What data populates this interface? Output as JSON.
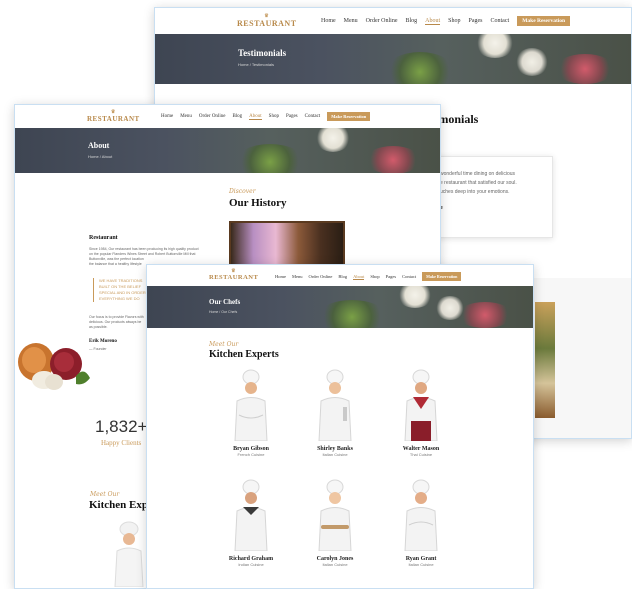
{
  "win_back": {
    "logo": "RESTAURANT",
    "menu": [
      "Home",
      "Menu",
      "Order Online",
      "Blog",
      "About",
      "Shop",
      "Pages",
      "Contact"
    ],
    "reservation": "Make Reservation",
    "hero_title": "Testimonials",
    "breadcrumb": "Home / Testimonials",
    "section_heading": "imonials",
    "quote_lines": [
      "wonderful time dining on delicious",
      "e restaurant that satisfied our soul.",
      "uches deep into your emotions."
    ],
    "quote_author": "e"
  },
  "win_mid": {
    "logo": "RESTAURANT",
    "menu": [
      "Home",
      "Menu",
      "Order Online",
      "Blog",
      "About",
      "Shop",
      "Pages",
      "Contact"
    ],
    "reservation": "Make Reservation",
    "hero_title": "About",
    "breadcrumb": "Home / About",
    "discover": "Discover",
    "history_heading": "Our History",
    "restaurant_label": "Restaurant",
    "body_lines": [
      "Since 1984, Our restaurant has been producing its high quality product",
      "on the popular Flanders Wines Street and Robert Buttonville Mill that",
      "Buttonville, was the perfect location",
      "the balance that a healthy lifestyle"
    ],
    "callout_lines": [
      "WE HAVE TRADITIONS",
      "BUILT ON THE BELIEF",
      "SPECIAL AND IN ORDER",
      "EVERYTHING WE DO"
    ],
    "body2_lines": [
      "Our focus is to provide Flavors with",
      "delicious. Our products always be",
      "as possible."
    ],
    "author_name": "Erik Moreno",
    "author_role": "— Founder",
    "stat_value": "1,832+",
    "stat_label": "Happy Clients",
    "meet_label": "Meet Our",
    "kitchen_partial": "Kitchen Exp"
  },
  "win_front": {
    "logo": "RESTAURANT",
    "menu": [
      "Home",
      "Menu",
      "Order Online",
      "Blog",
      "About",
      "Shop",
      "Pages",
      "Contact"
    ],
    "reservation": "Make Reservation",
    "hero_title": "Our Chefs",
    "breadcrumb": "Home / Our Chefs",
    "meet_label": "Meet Our",
    "kitchen_heading": "Kitchen Experts",
    "chefs": [
      {
        "name": "Bryan Gibson",
        "role": "French Cuisine"
      },
      {
        "name": "Shirley Banks",
        "role": "Italian Cuisine"
      },
      {
        "name": "Walter Mason",
        "role": "Thai Cuisine"
      },
      {
        "name": "Richard Graham",
        "role": "Indian Cuisine"
      },
      {
        "name": "Carolyn Jones",
        "role": "Italian Cuisine"
      },
      {
        "name": "Ryan Grant",
        "role": "Italian Cuisine"
      }
    ]
  },
  "colors": {
    "accent": "#c99a5a",
    "hero_dark": "#454c58",
    "window_border": "#c9dff2"
  }
}
